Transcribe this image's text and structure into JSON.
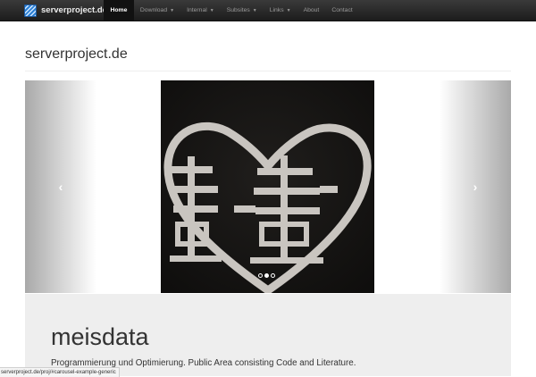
{
  "navbar": {
    "brand": "serverproject.de",
    "items": [
      {
        "label": "Home",
        "caret": "",
        "active": true
      },
      {
        "label": "Download",
        "caret": "▼",
        "active": false
      },
      {
        "label": "Internal",
        "caret": "▼",
        "active": false
      },
      {
        "label": "Subsites",
        "caret": "▼",
        "active": false
      },
      {
        "label": "Links",
        "caret": "▼",
        "active": false
      },
      {
        "label": "About",
        "caret": "",
        "active": false
      },
      {
        "label": "Contact",
        "caret": "",
        "active": false
      }
    ]
  },
  "page": {
    "title": "serverproject.de"
  },
  "carousel": {
    "prev_icon": "‹",
    "next_icon": "›",
    "slide_count": 3,
    "active_index": 1,
    "image_description_icon": "double-happiness-heart-image"
  },
  "jumbotron": {
    "title": "meisdata",
    "lead": "Programmierung und Optimierung. Public Area consisting Code and Literature."
  },
  "statusbar": {
    "url": "serverproject.de/proj/#carousel-example-generic"
  },
  "colors": {
    "navbar_bg": "#222222",
    "active_nav_bg": "#111111",
    "jumbotron_bg": "#eeeeee",
    "slide_bg": "#161514",
    "glyph_color": "#c9c5c0"
  }
}
